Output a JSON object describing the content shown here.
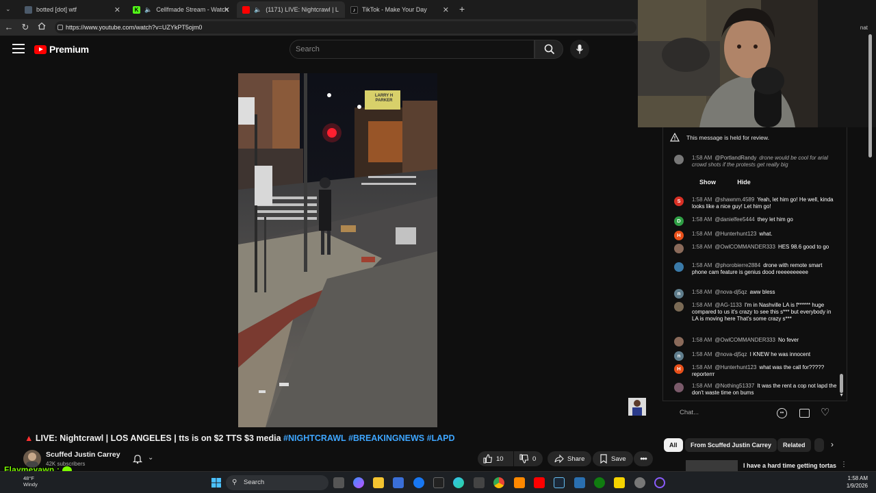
{
  "tabs": [
    {
      "title": "botted [dot] wtf",
      "fav_color": "#4b5a6a"
    },
    {
      "title": "Cellfmade Stream - Watch Liv",
      "fav_color": "#53fc18"
    },
    {
      "title": "(1171) LIVE: Nightcrawl | L",
      "fav_color": "#ff0000"
    },
    {
      "title": "TikTok - Make Your Day",
      "fav_color": "#111111"
    }
  ],
  "address": {
    "url": "https://www.youtube.com/watch?v=UZYkPT5ojm0"
  },
  "header": {
    "logo": "Premium",
    "search_placeholder": "Search"
  },
  "video": {
    "title_prefix": "LIVE: Nightcrawl | LOS ANGELES | tts is on $2 TTS $3 media",
    "tags": [
      "#NIGHTCRAWL",
      "#BREAKINGNEWS",
      "#LAPD"
    ],
    "sign_text": "LARRY H PARKER"
  },
  "channel": {
    "name": "Scuffed Justin Carrey",
    "subs": "42K subscribers"
  },
  "actions": {
    "likes": "10",
    "dislikes": "0",
    "share": "Share",
    "save": "Save"
  },
  "chat": {
    "held_notice": "This message is held for review.",
    "show": "Show",
    "hide": "Hide",
    "input_placeholder": "Chat...",
    "messages": [
      {
        "time": "1:58 AM",
        "user": "@PortlandRandy",
        "text": "drone would be cool for arial crowd shots if the protests get really big",
        "initial": "",
        "color": "#777777",
        "held": true
      },
      {
        "time": "1:58 AM",
        "user": "@shawnm.4589",
        "text": "Yeah, let him go! He well, kinda looks like a nice guy! Let him go!",
        "initial": "S",
        "color": "#d93025"
      },
      {
        "time": "1:58 AM",
        "user": "@danielfee5444",
        "text": "they let him go",
        "initial": "D",
        "color": "#2e9e44"
      },
      {
        "time": "1:58 AM",
        "user": "@Hunterhunt123",
        "text": "what.",
        "initial": "H",
        "color": "#e8501a"
      },
      {
        "time": "1:58 AM",
        "user": "@OwlCOMMANDER333",
        "text": "HES 98.6 good to go",
        "initial": "",
        "color": "#8a6a5a"
      },
      {
        "time": "1:58 AM",
        "user": "@phorobierre2884",
        "text": "drone with remote smart phone cam feature is genius dood reeeeeeeeee",
        "initial": "",
        "color": "#3a7aa8"
      },
      {
        "time": "1:58 AM",
        "user": "@nova-dj5qz",
        "text": "aww bless",
        "initial": "n",
        "color": "#5f7d8c"
      },
      {
        "time": "1:58 AM",
        "user": "@AG-1133",
        "text": "I'm in Nashville LA is f****** huge compared to us it's crazy to see this s*** but everybody in LA is moving here That's some crazy s***",
        "initial": "",
        "color": "#7a6a55"
      },
      {
        "time": "1:58 AM",
        "user": "@OwlCOMMANDER333",
        "text": "No fever",
        "initial": "",
        "color": "#8a6a5a"
      },
      {
        "time": "1:58 AM",
        "user": "@nova-dj5qz",
        "text": "I KNEW he was innocent",
        "initial": "n",
        "color": "#5f7d8c"
      },
      {
        "time": "1:58 AM",
        "user": "@Hunterhunt123",
        "text": "what was the call for????? reporterrr",
        "initial": "H",
        "color": "#e8501a"
      },
      {
        "time": "1:58 AM",
        "user": "@Nothing51337",
        "text": "It was the rent a cop not lapd the don't waste time on bums",
        "initial": "",
        "color": "#7a5a6a"
      }
    ]
  },
  "filters": [
    "All",
    "From Scuffed Justin Carrey",
    "Related"
  ],
  "related_preview": "I have a hard time getting tortas",
  "overlay": {
    "name": "Flaymeyawn :"
  },
  "taskbar": {
    "search": "Search",
    "temp": "48°F",
    "weather": "Windy",
    "time": "1:58 AM",
    "date": "1/9/2026"
  },
  "colors": {
    "accent_link": "#3ea6ff",
    "yt_red": "#ff0000",
    "overlay_green": "#7CFC00"
  }
}
